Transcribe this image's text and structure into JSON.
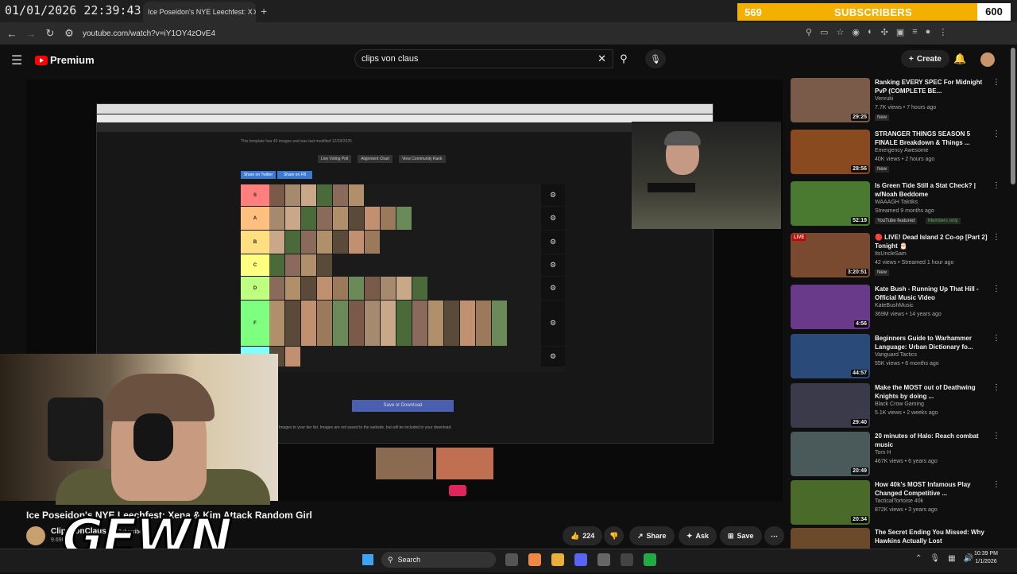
{
  "overlay": {
    "clock": "01/01/2026 22:39:43",
    "subgoal_current": "569",
    "subgoal_label": "SUBSCRIBERS",
    "subgoal_target": "600",
    "subgoal_progress": 0.0,
    "watermark": "GEWN"
  },
  "browser": {
    "tab_title": "Ice Poseidon's NYE Leechfest: X",
    "url": "youtube.com/watch?v=iY1OY4zOvE4"
  },
  "youtube": {
    "brand": "Premium",
    "search_value": "clips von claus",
    "create_label": "Create"
  },
  "embedded": {
    "template_note": "This template has 40 images and was last modified 12/29/2025",
    "btn_live_poll": "Live Voting Poll",
    "btn_alignment": "Alignment Chart",
    "btn_community": "View Community Rank",
    "share_twitter": "Share on Twitter",
    "share_fb": "Share on FB",
    "save_download": "Save or Download",
    "images_note": "Images to your tier list. Images are not saved to the website, but will be included in your download.",
    "tiers": [
      {
        "label": "S",
        "color": "#ff7f7f",
        "count": 6
      },
      {
        "label": "A",
        "color": "#ffbf7f",
        "count": 9
      },
      {
        "label": "B",
        "color": "#ffdf7f",
        "count": 7
      },
      {
        "label": "C",
        "color": "#ffff7f",
        "count": 4
      },
      {
        "label": "D",
        "color": "#bfff7f",
        "count": 10
      },
      {
        "label": "F",
        "color": "#7fff7f",
        "count": 15
      },
      {
        "label": "",
        "color": "#7fffff",
        "count": 2
      }
    ]
  },
  "video": {
    "title": "Ice Poseidon's NYE Leechfest: Xena & Kim Attack Random Girl",
    "channel": "ClipsVonClaus",
    "subs": "9.69K",
    "subscribe": "Subscribe",
    "likes": "224",
    "share": "Share",
    "ask": "Ask",
    "save": "Save"
  },
  "recs": [
    {
      "title": "Ranking EVERY SPEC For Midnight PvP (COMPLETE BE...",
      "channel": "Venruki",
      "meta": "7.7K views • 7 hours ago",
      "badge": "New",
      "dur": "29:25",
      "color": "#7a5a48"
    },
    {
      "title": "STRANGER THINGS SEASON 5 FINALE Breakdown & Things ...",
      "channel": "Emergency Awesome",
      "meta": "40K views • 2 hours ago",
      "badge": "New",
      "dur": "28:56",
      "color": "#8a4a20"
    },
    {
      "title": "Is Green Tide Still a Stat Check? | w/Noah Beddome",
      "channel": "WAAAGH Taktiks",
      "meta": "Streamed 9 months ago",
      "badge": "YouTube featured",
      "badge2": "Members only",
      "dur": "52:19",
      "color": "#4a7a30"
    },
    {
      "title": "🔴 LIVE! Dead Island 2 Co-op [Part 2] Tonight 🎅",
      "channel": "ItsUncleSam",
      "meta": "42 views • Streamed 1 hour ago",
      "badge": "New",
      "dur": "3:20:51",
      "live": "LIVE",
      "color": "#7a4a30"
    },
    {
      "title": "Kate Bush - Running Up That Hill - Official Music Video",
      "channel": "KateBushMusic",
      "meta": "369M views • 14 years ago",
      "dur": "4:56",
      "color": "#6a3a8a"
    },
    {
      "title": "Beginners Guide to Warhammer Language: Urban Dictionary fo...",
      "channel": "Vanguard Tactics",
      "meta": "55K views • 6 months ago",
      "dur": "44:57",
      "color": "#2a4a7a"
    },
    {
      "title": "Make the MOST out of Deathwing Knights by doing ...",
      "channel": "Black Crow Gaming",
      "meta": "5.1K views • 2 weeks ago",
      "dur": "29:40",
      "color": "#3a3a4a"
    },
    {
      "title": "20 minutes of Halo: Reach combat music",
      "channel": "Tom H",
      "meta": "467K views • 6 years ago",
      "dur": "20:49",
      "color": "#4a5a5a"
    },
    {
      "title": "How 40k's MOST Infamous Play Changed Competitive ...",
      "channel": "TacticalTortoise 40k",
      "meta": "872K views • 3 years ago",
      "dur": "20:34",
      "color": "#4a6a2a"
    },
    {
      "title": "The Secret Ending You Missed: Why Hawkins Actually Lost",
      "channel": "",
      "meta": "",
      "dur": "",
      "color": "#6a4a2a"
    }
  ],
  "taskbar": {
    "search": "Search",
    "time": "10:39 PM",
    "date": "1/1/2026"
  }
}
